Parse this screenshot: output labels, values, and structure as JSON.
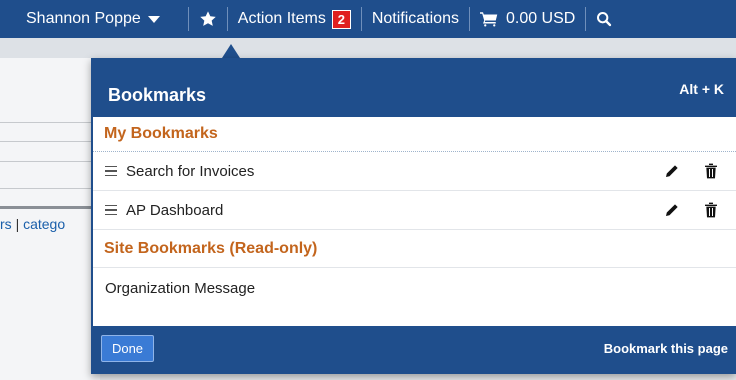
{
  "topbar": {
    "user_name": "Shannon Poppe",
    "action_items_label": "Action Items",
    "action_items_count": "2",
    "notifications_label": "Notifications",
    "cart_amount": "0.00 USD"
  },
  "background": {
    "links_text_a": "rs",
    "links_separator": "|",
    "links_text_b": "catego"
  },
  "popover": {
    "title": "Bookmarks",
    "shortcut": "Alt + K",
    "my_bookmarks_title": "My Bookmarks",
    "my_bookmarks": [
      {
        "label": "Search for Invoices"
      },
      {
        "label": "AP Dashboard"
      }
    ],
    "site_bookmarks_title": "Site Bookmarks (Read-only)",
    "site_bookmarks": [
      {
        "label": "Organization Message"
      }
    ],
    "done_label": "Done",
    "bookmark_this_page_label": "Bookmark this page"
  },
  "colors": {
    "brand_blue": "#1f4e8c",
    "section_orange": "#c3651d",
    "badge_red": "#e02020"
  },
  "icons": [
    "caret-down-icon",
    "star-icon",
    "cart-icon",
    "search-icon",
    "drag-handle-icon",
    "pencil-icon",
    "trash-icon"
  ]
}
